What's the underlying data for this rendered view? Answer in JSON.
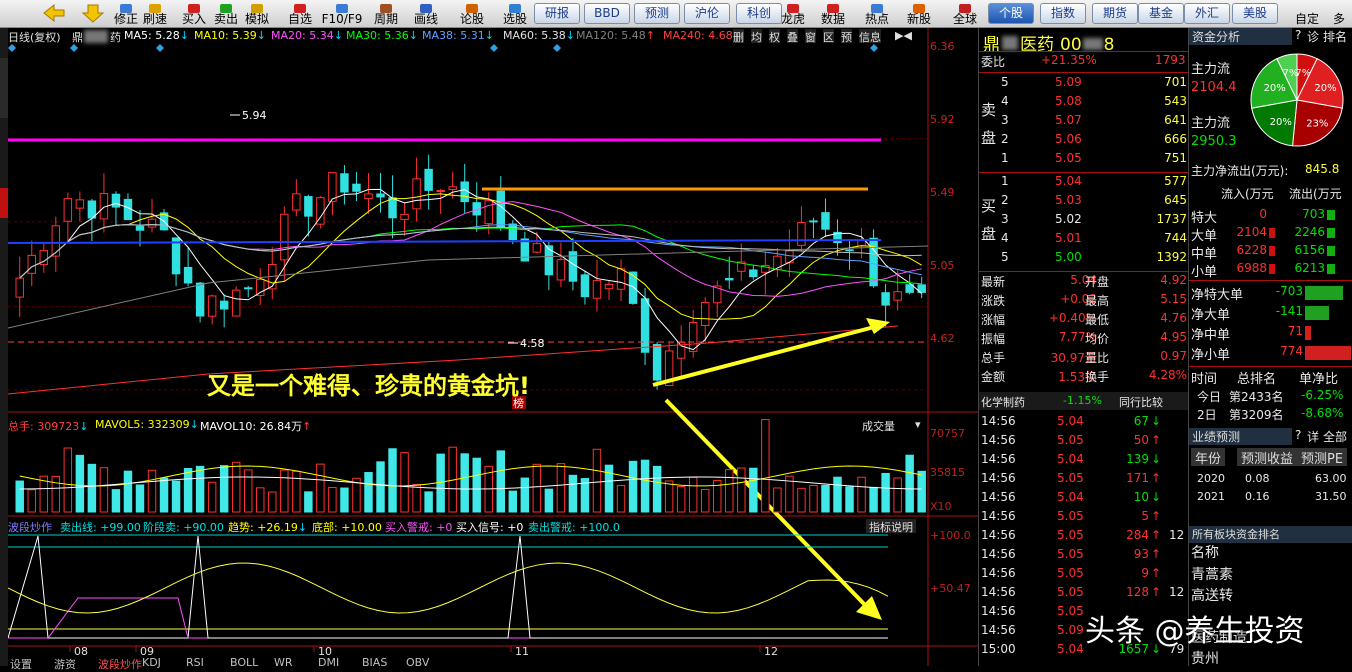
{
  "toolbar": {
    "icons": [
      "修正",
      "刷速",
      "买入",
      "卖出",
      "模拟",
      "自选",
      "F10/F9",
      "周期",
      "画线",
      "论股",
      "选股"
    ],
    "buttons": [
      "研报",
      "BBD",
      "预测",
      "沪伦",
      "科创",
      "龙虎",
      "数据",
      "热点",
      "新股",
      "全球"
    ],
    "market_tabs": [
      "个股",
      "指数",
      "期货",
      "基金",
      "外汇",
      "美股"
    ],
    "right_items": [
      "自定",
      "多"
    ],
    "colors": {
      "accent": "#1d55b0"
    }
  },
  "chart_header": {
    "period": "日线(复权)",
    "stock_short": "鼎",
    "stock_suffix": "药",
    "ma": [
      {
        "label": "MA5: 5.28",
        "arrow": "↓",
        "color": "#ffffff"
      },
      {
        "label": "MA10: 5.39",
        "arrow": "↓",
        "color": "#ffff00"
      },
      {
        "label": "MA20: 5.34",
        "arrow": "↓",
        "color": "#ff50ff"
      },
      {
        "label": "MA30: 5.36",
        "arrow": "↓",
        "color": "#00ff00"
      },
      {
        "label": "MA38: 5.31",
        "arrow": "↓",
        "color": "#60a0ff"
      },
      {
        "label": "MA60: 5.38",
        "arrow": "↓",
        "color": "#e0e0e0"
      },
      {
        "label": "MA120: 5.48",
        "arrow": "↑",
        "color": "#808080"
      },
      {
        "label": "MA240: 4.68",
        "arrow": "↑",
        "color": "#ff4040"
      }
    ],
    "side_icons": [
      "删",
      "均",
      "权",
      "叠",
      "窗",
      "区",
      "预",
      "信息"
    ]
  },
  "price_axis": [
    "6.36",
    "5.92",
    "5.49",
    "5.05",
    "4.62"
  ],
  "annotations": {
    "high": "5.94",
    "low": "4.58",
    "bang": "榜",
    "headline": "又是一个难得、珍贵的黄金坑!"
  },
  "volume": {
    "header": [
      {
        "label": "总手: 309723",
        "arrow": "↓",
        "color": "#ff4040"
      },
      {
        "label": "MAVOL5: 332309",
        "arrow": "↓",
        "color": "#ffff00"
      },
      {
        "label": "MAVOL10: 26.84万",
        "arrow": "↑",
        "color": "#ffffff"
      }
    ],
    "menu": "成交量",
    "axis": [
      "70757",
      "35815",
      "X10"
    ]
  },
  "indicator": {
    "header": [
      {
        "label": "波段炒作",
        "color": "#8080ff"
      },
      {
        "label": "卖出线: +99.00",
        "color": "#00e0e0"
      },
      {
        "label": "阶段卖: +90.00",
        "color": "#00e0e0"
      },
      {
        "label": "趋势: +26.19",
        "arrow": "↓",
        "color": "#ffff00"
      },
      {
        "label": "底部: +10.00",
        "color": "#ffff00"
      },
      {
        "label": "买入警戒: +0",
        "color": "#ff50ff"
      },
      {
        "label": "买入信号: +0",
        "color": "#ffffff"
      },
      {
        "label": "卖出警戒: +100.0",
        "color": "#00e0e0"
      }
    ],
    "button": "指标说明",
    "axis": [
      "+100.0",
      "+50.47"
    ]
  },
  "date_axis": [
    "08",
    "09",
    "10",
    "11",
    "12"
  ],
  "bottom_tabs": [
    "设置",
    "游资",
    "波段炒作",
    "KDJ",
    "RSI",
    "BOLL",
    "WR",
    "DMI",
    "BIAS",
    "OBV"
  ],
  "quote": {
    "title_a": "鼎",
    "title_b": "医药",
    "title_code_a": "00",
    "title_code_b": "8",
    "weibi_label": "委比",
    "weibi_pct": "+21.35%",
    "weibi_val": "1793",
    "sell_label": "卖盘",
    "buy_label": "买盘",
    "sell": [
      {
        "lvl": "5",
        "price": "5.09",
        "vol": "701"
      },
      {
        "lvl": "4",
        "price": "5.08",
        "vol": "543"
      },
      {
        "lvl": "3",
        "price": "5.07",
        "vol": "641"
      },
      {
        "lvl": "2",
        "price": "5.06",
        "vol": "666"
      },
      {
        "lvl": "1",
        "price": "5.05",
        "vol": "751"
      }
    ],
    "buy": [
      {
        "lvl": "1",
        "price": "5.04",
        "vol": "577"
      },
      {
        "lvl": "2",
        "price": "5.03",
        "vol": "645"
      },
      {
        "lvl": "3",
        "price": "5.02",
        "vol": "1737"
      },
      {
        "lvl": "4",
        "price": "5.01",
        "vol": "744"
      },
      {
        "lvl": "5",
        "price": "5.00",
        "vol": "1392"
      }
    ],
    "stats": [
      [
        "最新",
        "5.04",
        "开盘",
        "4.92"
      ],
      [
        "涨跌",
        "+0.02",
        "最高",
        "5.15"
      ],
      [
        "涨幅",
        "+0.40%",
        "最低",
        "4.76"
      ],
      [
        "振幅",
        "7.77%",
        "均价",
        "4.95"
      ],
      [
        "总手",
        "30.97万",
        "量比",
        "0.97"
      ],
      [
        "金额",
        "1.53亿",
        "换手",
        "4.28%"
      ]
    ],
    "sector": "化学制药",
    "sector_pct": "-1.15%",
    "compare": "同行比较",
    "ticks": [
      {
        "t": "14:56",
        "p": "5.04",
        "v": "67",
        "a": "↓",
        "c": "g"
      },
      {
        "t": "14:56",
        "p": "5.05",
        "v": "50",
        "a": "↑",
        "c": "r"
      },
      {
        "t": "14:56",
        "p": "5.04",
        "v": "139",
        "a": "↓",
        "c": "g"
      },
      {
        "t": "14:56",
        "p": "5.05",
        "v": "171",
        "a": "↑",
        "c": "r"
      },
      {
        "t": "14:56",
        "p": "5.04",
        "v": "10",
        "a": "↓",
        "c": "g"
      },
      {
        "t": "14:56",
        "p": "5.05",
        "v": "5",
        "a": "↑",
        "c": "r"
      },
      {
        "t": "14:56",
        "p": "5.05",
        "v": "284",
        "a": "↑",
        "c": "r",
        "x": "12"
      },
      {
        "t": "14:56",
        "p": "5.05",
        "v": "93",
        "a": "↑",
        "c": "r"
      },
      {
        "t": "14:56",
        "p": "5.05",
        "v": "9",
        "a": "↑",
        "c": "r"
      },
      {
        "t": "14:56",
        "p": "5.05",
        "v": "128",
        "a": "↑",
        "c": "r",
        "x": "12"
      },
      {
        "t": "14:56",
        "p": "5.05",
        "v": "",
        "a": "",
        "c": "r"
      },
      {
        "t": "14:56",
        "p": "5.09",
        "v": "",
        "a": "",
        "c": "r"
      },
      {
        "t": "15:00",
        "p": "5.04",
        "v": "1657",
        "a": "↓",
        "c": "g",
        "x": "79"
      }
    ]
  },
  "funds": {
    "title": "资金分析",
    "q": "?",
    "zhen": "诊",
    "rank": "排名",
    "zl_in": "主力流",
    "zl_in_val": "2104.4",
    "zl_out": "主力流",
    "zl_out_val": "2950.3",
    "pie": [
      {
        "label": "7%",
        "value": 7,
        "color": "#d01010"
      },
      {
        "label": "20%",
        "value": 20,
        "color": "#e02020"
      },
      {
        "label": "23%",
        "value": 23,
        "color": "#a80000"
      },
      {
        "label": "20%",
        "value": 20,
        "color": "#007a00"
      },
      {
        "label": "20%",
        "value": 20,
        "color": "#20b020"
      },
      {
        "label": "7%",
        "value": 7,
        "color": "#50d050"
      }
    ],
    "net_label": "主力净流出(万元):",
    "net_val": "845.8",
    "flow_in": "流入(万元",
    "flow_out": "流出(万元",
    "flows": [
      {
        "name": "特大",
        "in": "0",
        "out": "703"
      },
      {
        "name": "大单",
        "in": "2104",
        "out": "2246"
      },
      {
        "name": "中单",
        "in": "6228",
        "out": "6156"
      },
      {
        "name": "小单",
        "in": "6988",
        "out": "6213"
      }
    ],
    "nets": [
      {
        "name": "净特大单",
        "val": "-703",
        "c": "g"
      },
      {
        "name": "净大单",
        "val": "-141",
        "c": "g"
      },
      {
        "name": "净中单",
        "val": "71",
        "c": "r"
      },
      {
        "name": "净小单",
        "val": "774",
        "c": "r"
      }
    ],
    "rank_hdr": [
      "时间",
      "总排名",
      "单净比"
    ],
    "rank_rows": [
      {
        "t": "今日",
        "r": "第2433名",
        "p": "-6.25%"
      },
      {
        "t": "2日",
        "r": "第3209名",
        "p": "-8.68%"
      }
    ],
    "forecast_title": "业绩预测",
    "forecast_q": "?",
    "forecast_detail": "详",
    "forecast_all": "全部",
    "forecast_tabs": [
      "年份",
      "预测收益",
      "预测PE"
    ],
    "forecast_rows": [
      {
        "y": "2020",
        "e": "0.08",
        "pe": "63.00"
      },
      {
        "y": "2021",
        "e": "0.16",
        "pe": "31.50"
      }
    ],
    "board_title": "所有板块资金排名",
    "board_hdr": "名称",
    "boards": [
      "青蒿素",
      "高送转",
      "",
      "医药制造",
      "贵州"
    ]
  },
  "watermark": "头条 @养生投资",
  "chart_data": {
    "type": "candlestick",
    "y_range": [
      4.5,
      6.4
    ],
    "x_labels": [
      "08",
      "09",
      "10",
      "11",
      "12"
    ],
    "marked_high": 5.94,
    "marked_low": 4.58,
    "last_close": 5.04
  }
}
